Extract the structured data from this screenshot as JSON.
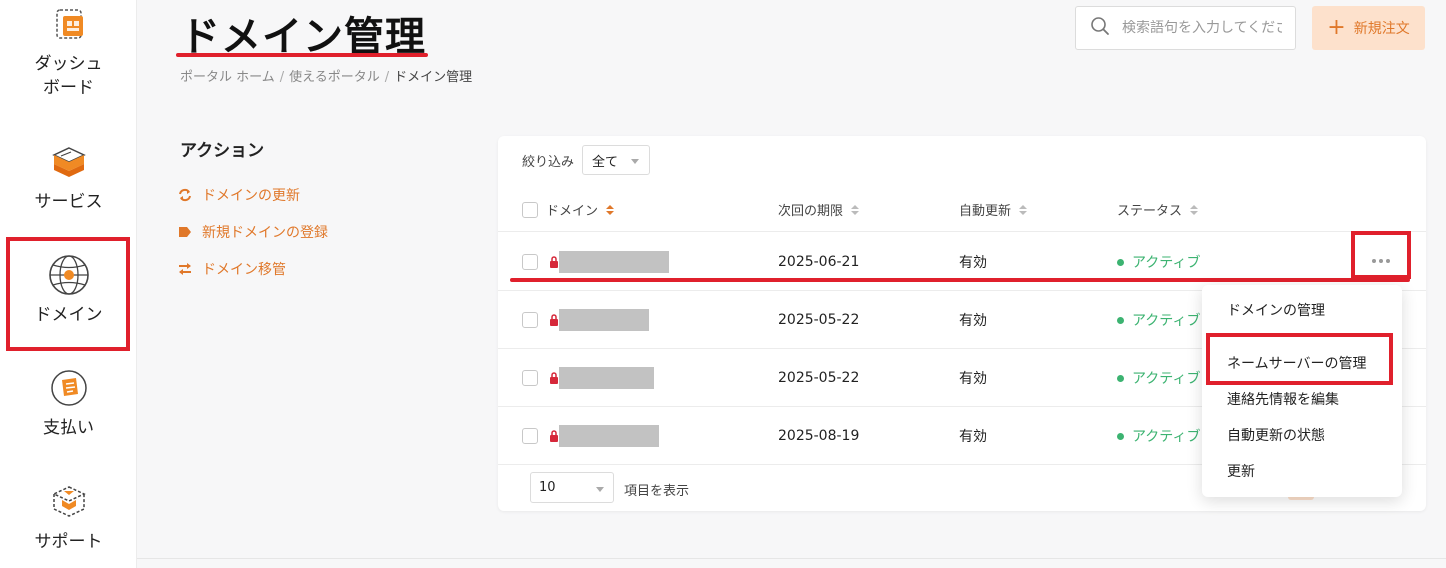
{
  "sidebar": {
    "items": [
      {
        "label": "ダッシュ\nボード",
        "icon": "dashboard-icon"
      },
      {
        "label": "サービス",
        "icon": "server-box-icon"
      },
      {
        "label": "ドメイン",
        "icon": "globe-icon",
        "active": true
      },
      {
        "label": "支払い",
        "icon": "billing-icon"
      },
      {
        "label": "サポート",
        "icon": "support-box-icon"
      }
    ]
  },
  "header": {
    "title": "ドメイン管理",
    "breadcrumb": [
      "ポータル ホーム",
      "使えるポータル",
      "ドメイン管理"
    ],
    "search_placeholder": "検索語句を入力してください",
    "new_order_label": "新規注文"
  },
  "actions": {
    "title": "アクション",
    "links": [
      {
        "label": "ドメインの更新",
        "icon": "refresh-icon"
      },
      {
        "label": "新規ドメインの登録",
        "icon": "tag-icon"
      },
      {
        "label": "ドメイン移管",
        "icon": "transfer-icon"
      }
    ]
  },
  "table": {
    "filter_label": "絞り込み",
    "filter_value": "全て",
    "columns": [
      "ドメイン",
      "次回の期限",
      "自動更新",
      "ステータス"
    ],
    "rows": [
      {
        "domain": "",
        "next_due": "2025-06-21",
        "auto_renew": "有効",
        "status": "アクティブ"
      },
      {
        "domain": "",
        "next_due": "2025-05-22",
        "auto_renew": "有効",
        "status": "アクティブ"
      },
      {
        "domain": "",
        "next_due": "2025-05-22",
        "auto_renew": "有効",
        "status": "アクティブ"
      },
      {
        "domain": "",
        "next_due": "2025-08-19",
        "auto_renew": "有効",
        "status": "アクティブ"
      }
    ],
    "page_size": "10",
    "page_size_label": "項目を表示"
  },
  "dropdown": {
    "items": [
      "ドメインの管理",
      "ネームサーバーの管理",
      "連絡先情報を編集",
      "自動更新の状態",
      "更新"
    ]
  },
  "colors": {
    "accent": "#e0782a",
    "highlight": "#e0202c",
    "status_active": "#3cb371"
  }
}
